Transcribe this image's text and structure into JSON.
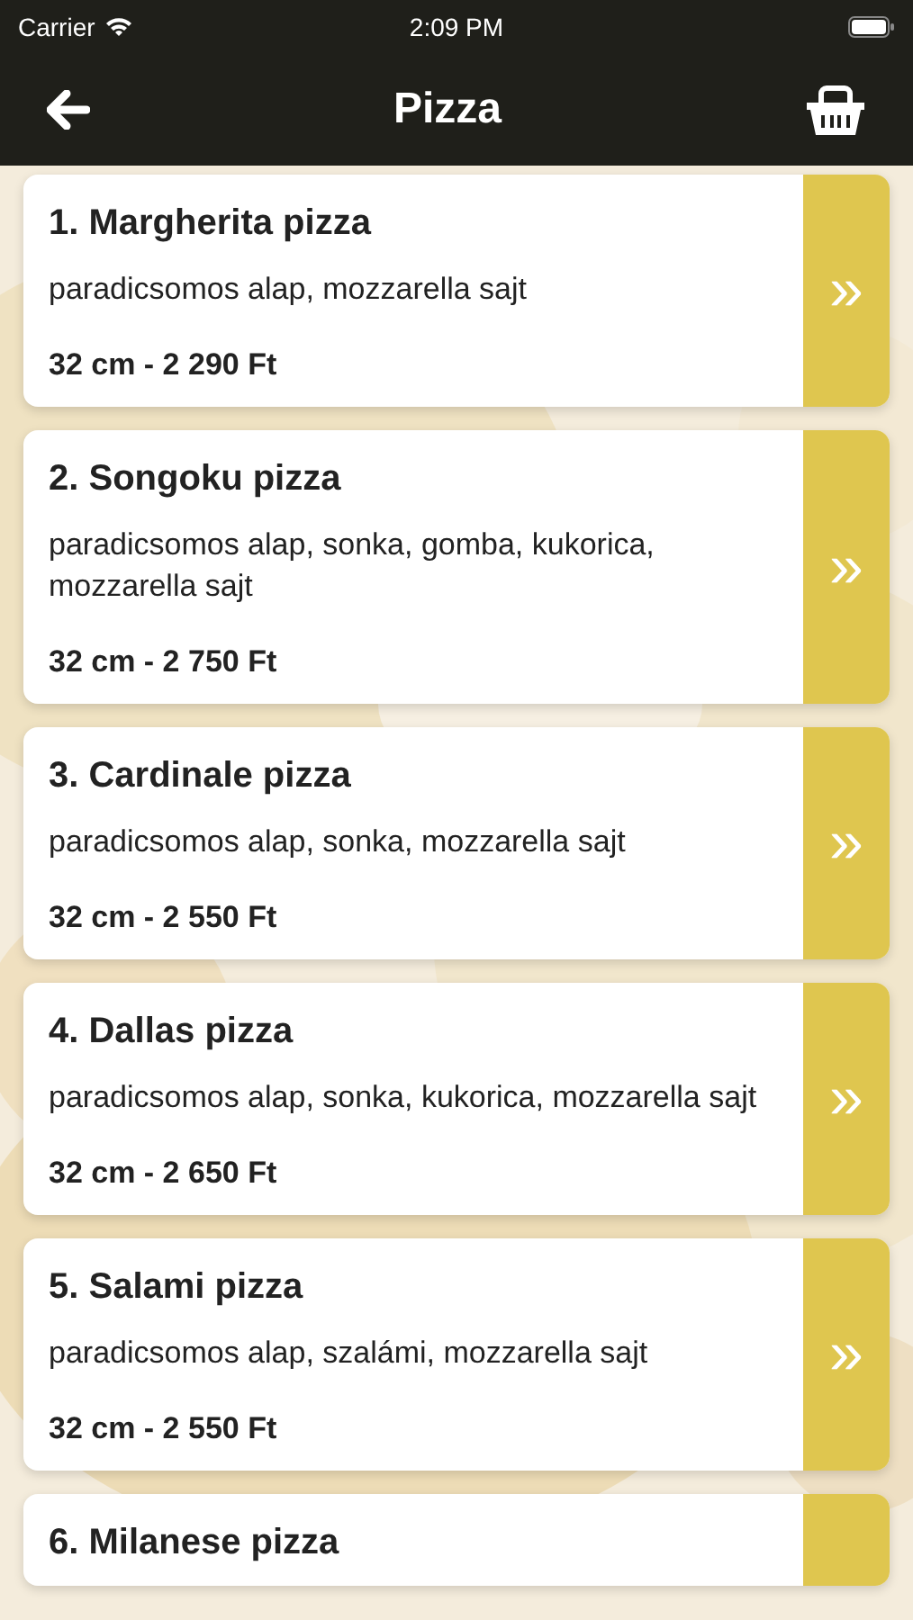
{
  "status_bar": {
    "carrier": "Carrier",
    "time": "2:09 PM"
  },
  "header": {
    "title": "Pizza"
  },
  "items": [
    {
      "name": "1. Margherita pizza",
      "description": "paradicsomos alap, mozzarella sajt",
      "price": "32 cm - 2 290 Ft",
      "action": "»"
    },
    {
      "name": "2. Songoku pizza",
      "description": "paradicsomos alap, sonka, gomba, kukorica, mozzarella sajt",
      "price": "32 cm - 2 750 Ft",
      "action": "»"
    },
    {
      "name": "3. Cardinale pizza",
      "description": "paradicsomos alap, sonka, mozzarella sajt",
      "price": "32 cm - 2 550 Ft",
      "action": "»"
    },
    {
      "name": "4. Dallas pizza",
      "description": "paradicsomos alap, sonka, kukorica, mozzarella sajt",
      "price": "32 cm - 2 650 Ft",
      "action": "»"
    },
    {
      "name": "5. Salami pizza",
      "description": "paradicsomos alap, szalámi, mozzarella sajt",
      "price": "32 cm - 2 550 Ft",
      "action": "»"
    },
    {
      "name": "6. Milanese pizza"
    }
  ]
}
